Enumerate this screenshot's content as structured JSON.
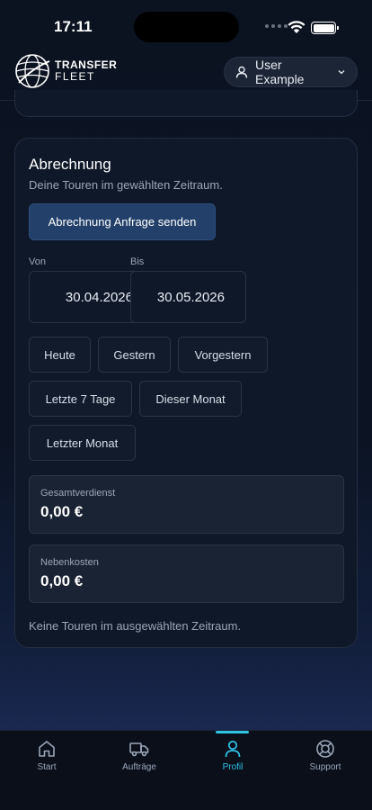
{
  "status_bar": {
    "time": "17:11"
  },
  "header": {
    "logo_line1": "TRANSFER",
    "logo_line2": "FLEET",
    "user_name": "User Example"
  },
  "billing": {
    "title": "Abrechnung",
    "subtitle": "Deine Touren im gewählten Zeitraum.",
    "request_button": "Abrechnung Anfrage senden",
    "from_label": "Von",
    "to_label": "Bis",
    "from_date": "30.04.2026",
    "to_date": "30.05.2026",
    "presets": [
      "Heute",
      "Gestern",
      "Vorgestern",
      "Letzte 7 Tage",
      "Dieser Monat",
      "Letzter Monat"
    ],
    "total_earnings_label": "Gesamtverdienst",
    "total_earnings_value": "0,00 €",
    "extra_costs_label": "Nebenkosten",
    "extra_costs_value": "0,00 €",
    "empty_message": "Keine Touren im ausgewählten Zeitraum."
  },
  "nav": {
    "items": [
      {
        "label": "Start",
        "icon": "home-icon"
      },
      {
        "label": "Aufträge",
        "icon": "truck-icon"
      },
      {
        "label": "Profil",
        "icon": "user-icon"
      },
      {
        "label": "Support",
        "icon": "lifebuoy-icon"
      }
    ],
    "active": "Profil"
  },
  "colors": {
    "accent": "#2ec4e6",
    "primary_button": "#22406a",
    "background": "#0b1220"
  }
}
